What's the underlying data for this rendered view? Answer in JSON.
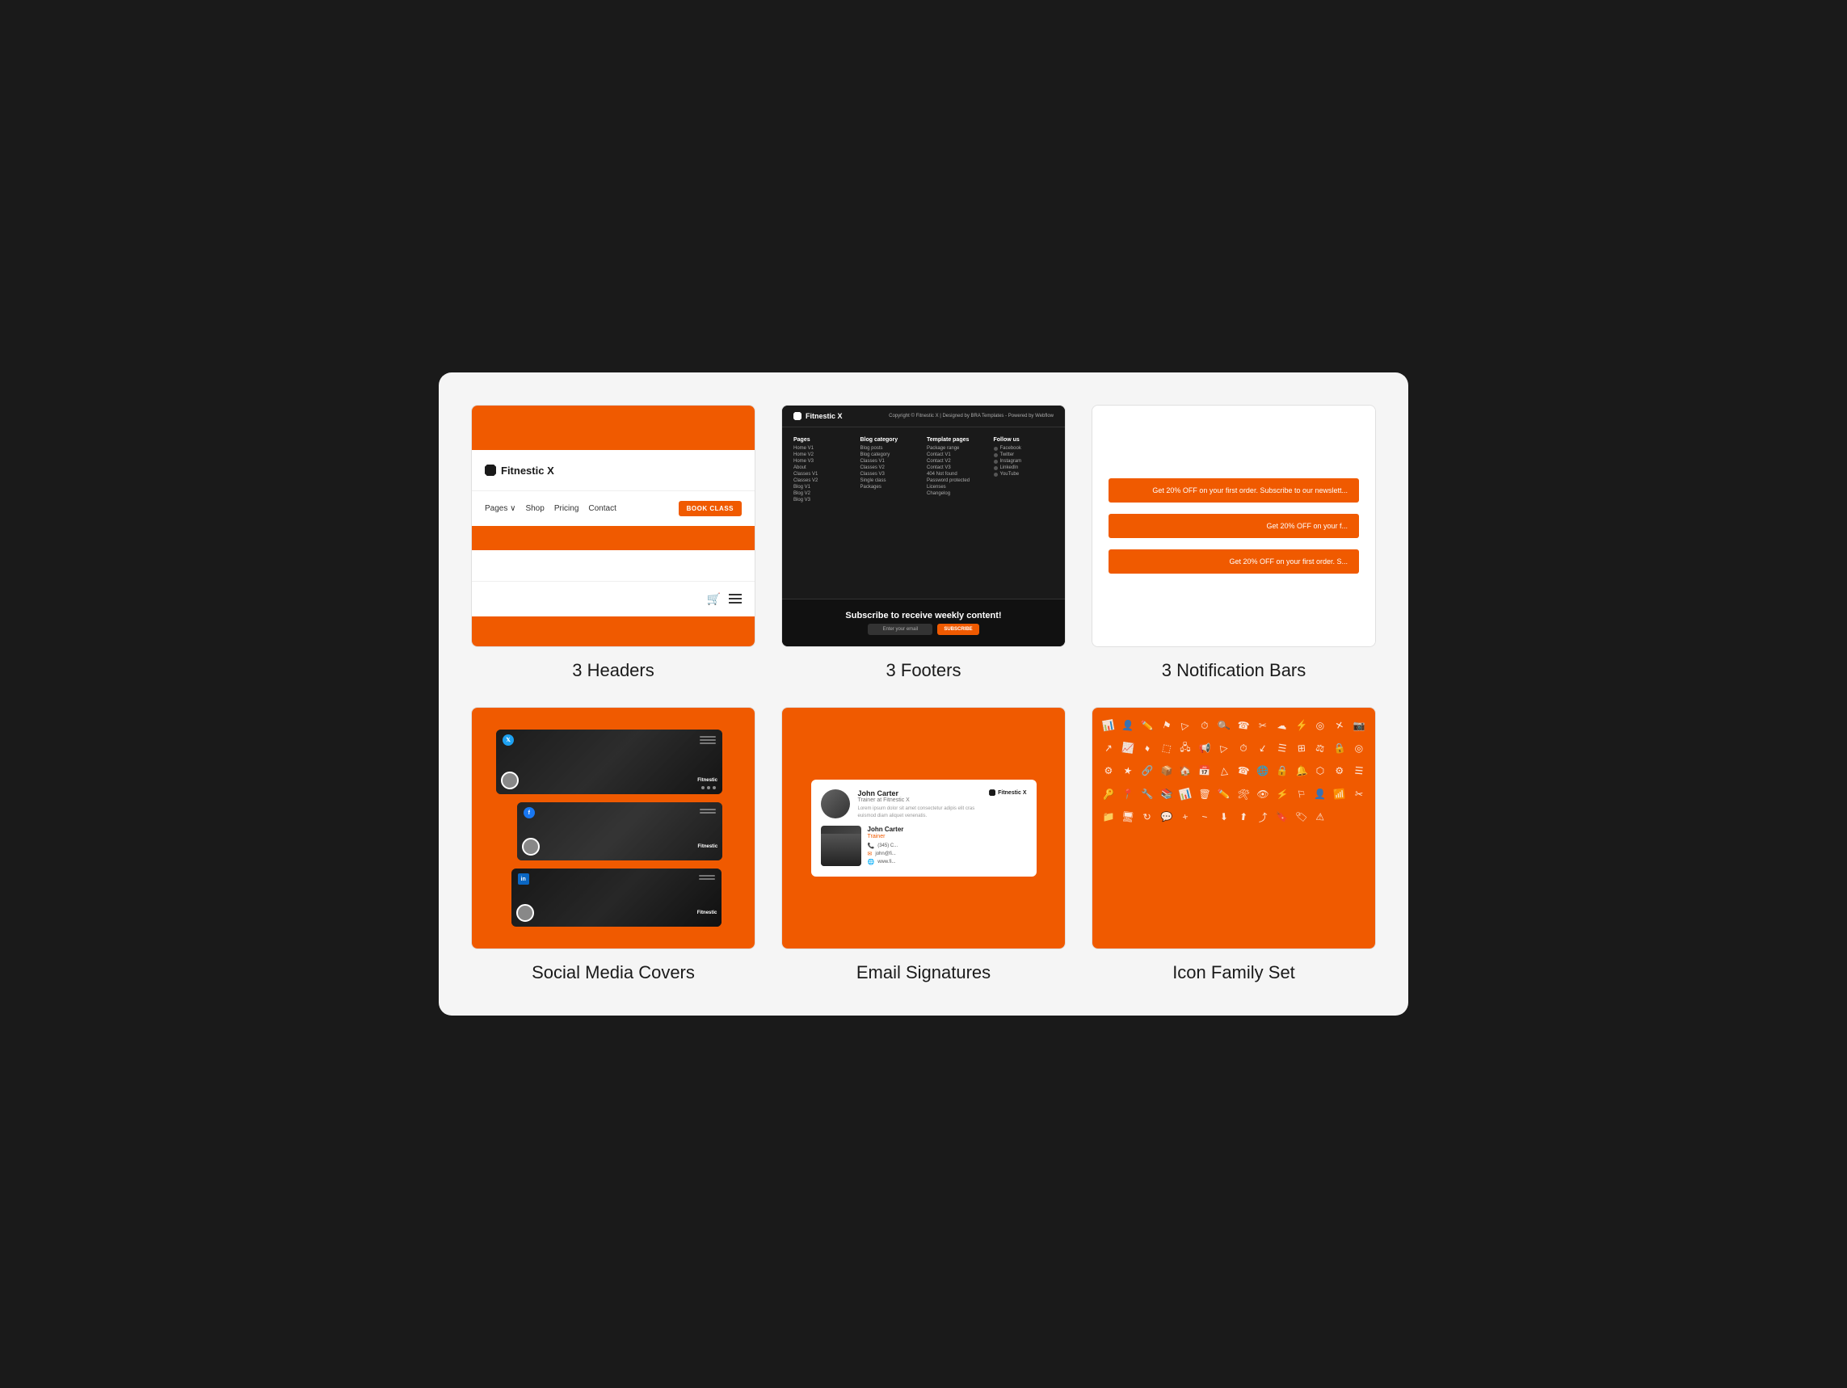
{
  "page": {
    "background": "#1a1a1a",
    "container_bg": "#f5f5f5"
  },
  "cards": [
    {
      "id": "headers",
      "label": "3 Headers",
      "preview_type": "headers"
    },
    {
      "id": "footers",
      "label": "3 Footers",
      "preview_type": "footers"
    },
    {
      "id": "notification-bars",
      "label": "3 Notification Bars",
      "preview_type": "notification-bars"
    },
    {
      "id": "social-media-covers",
      "label": "Social Media Covers",
      "preview_type": "social"
    },
    {
      "id": "email-signatures",
      "label": "Email Signatures",
      "preview_type": "email"
    },
    {
      "id": "icon-family",
      "label": "Icon Family Set",
      "preview_type": "icons"
    }
  ],
  "headers": {
    "logo": "Fitnestic X",
    "nav_items": [
      "Pages",
      "Shop",
      "Pricing",
      "Contact"
    ],
    "book_btn": "BOOK CLASS",
    "orange_color": "#f05a00"
  },
  "footers": {
    "logo": "Fitnestic X",
    "subtitle": "Copyright © Fitnestic X | Designed by BRA Templates - Powered by Webflow",
    "pages_title": "Pages",
    "pages_items": [
      "Home V1",
      "Home V2",
      "Home V3",
      "About",
      "Classes V1",
      "Classes V2",
      "Blog V1",
      "Blog V2",
      "Blog V3"
    ],
    "blog_title": "Blog category",
    "blog_items": [
      "Blog posts",
      "Blog category",
      "Classes V1",
      "Classes V2",
      "Classes V3",
      "Single class",
      "Packages"
    ],
    "template_title": "Template pages",
    "template_items": [
      "Package range",
      "Contact V1",
      "Contact V2",
      "Contact V3",
      "404 Not found",
      "Password protected",
      "Licenses",
      "Changelog"
    ],
    "follow_title": "Follow us",
    "follow_items": [
      "Facebook",
      "Twitter",
      "Instagram",
      "LinkedIn",
      "YouTube"
    ],
    "newsletter_title": "Subscribe to receive weekly content!",
    "newsletter_placeholder": "Enter your email",
    "newsletter_btn": "SUBSCRIBE"
  },
  "notification": {
    "bars": [
      "Get 20% OFF on your first order. Subscribe to our newslett...",
      "Get 20% OFF on your f...",
      "Get 20% OFF on your first order. S..."
    ]
  },
  "email": {
    "name": "John Carter",
    "title": "Trainer at Fitnestic X",
    "body": "Lorem ipsum dolor sit amet consectetur adipis elit\ncras euismod diam aliquet venenatis.",
    "logo": "Fitnestic X",
    "det_name": "John Carter",
    "det_role": "Trainer",
    "phone": "(345) C...",
    "email": "john@fi...",
    "website": "www.fi..."
  },
  "icons": [
    "⬡",
    "✎",
    "⚐",
    "▷",
    "⏱",
    "🔍",
    "☊",
    "✂",
    "☁",
    "⚡",
    "◎",
    "✕",
    "🖿",
    "📷",
    "🔖",
    "⚙",
    "★",
    "🔗",
    "↗",
    "📊",
    "♦",
    "⬚",
    "🖧",
    "⚑",
    "📢",
    "▷",
    "⏱",
    "↙",
    "☰",
    "⊞",
    "⚖",
    "🔒",
    "◎",
    "⚙",
    "✦",
    "📦",
    "🏠",
    "📅",
    "△",
    "☎",
    "🌐",
    "🔒",
    "🔔",
    "⬡",
    "⚙",
    "☰",
    "🔑"
  ]
}
